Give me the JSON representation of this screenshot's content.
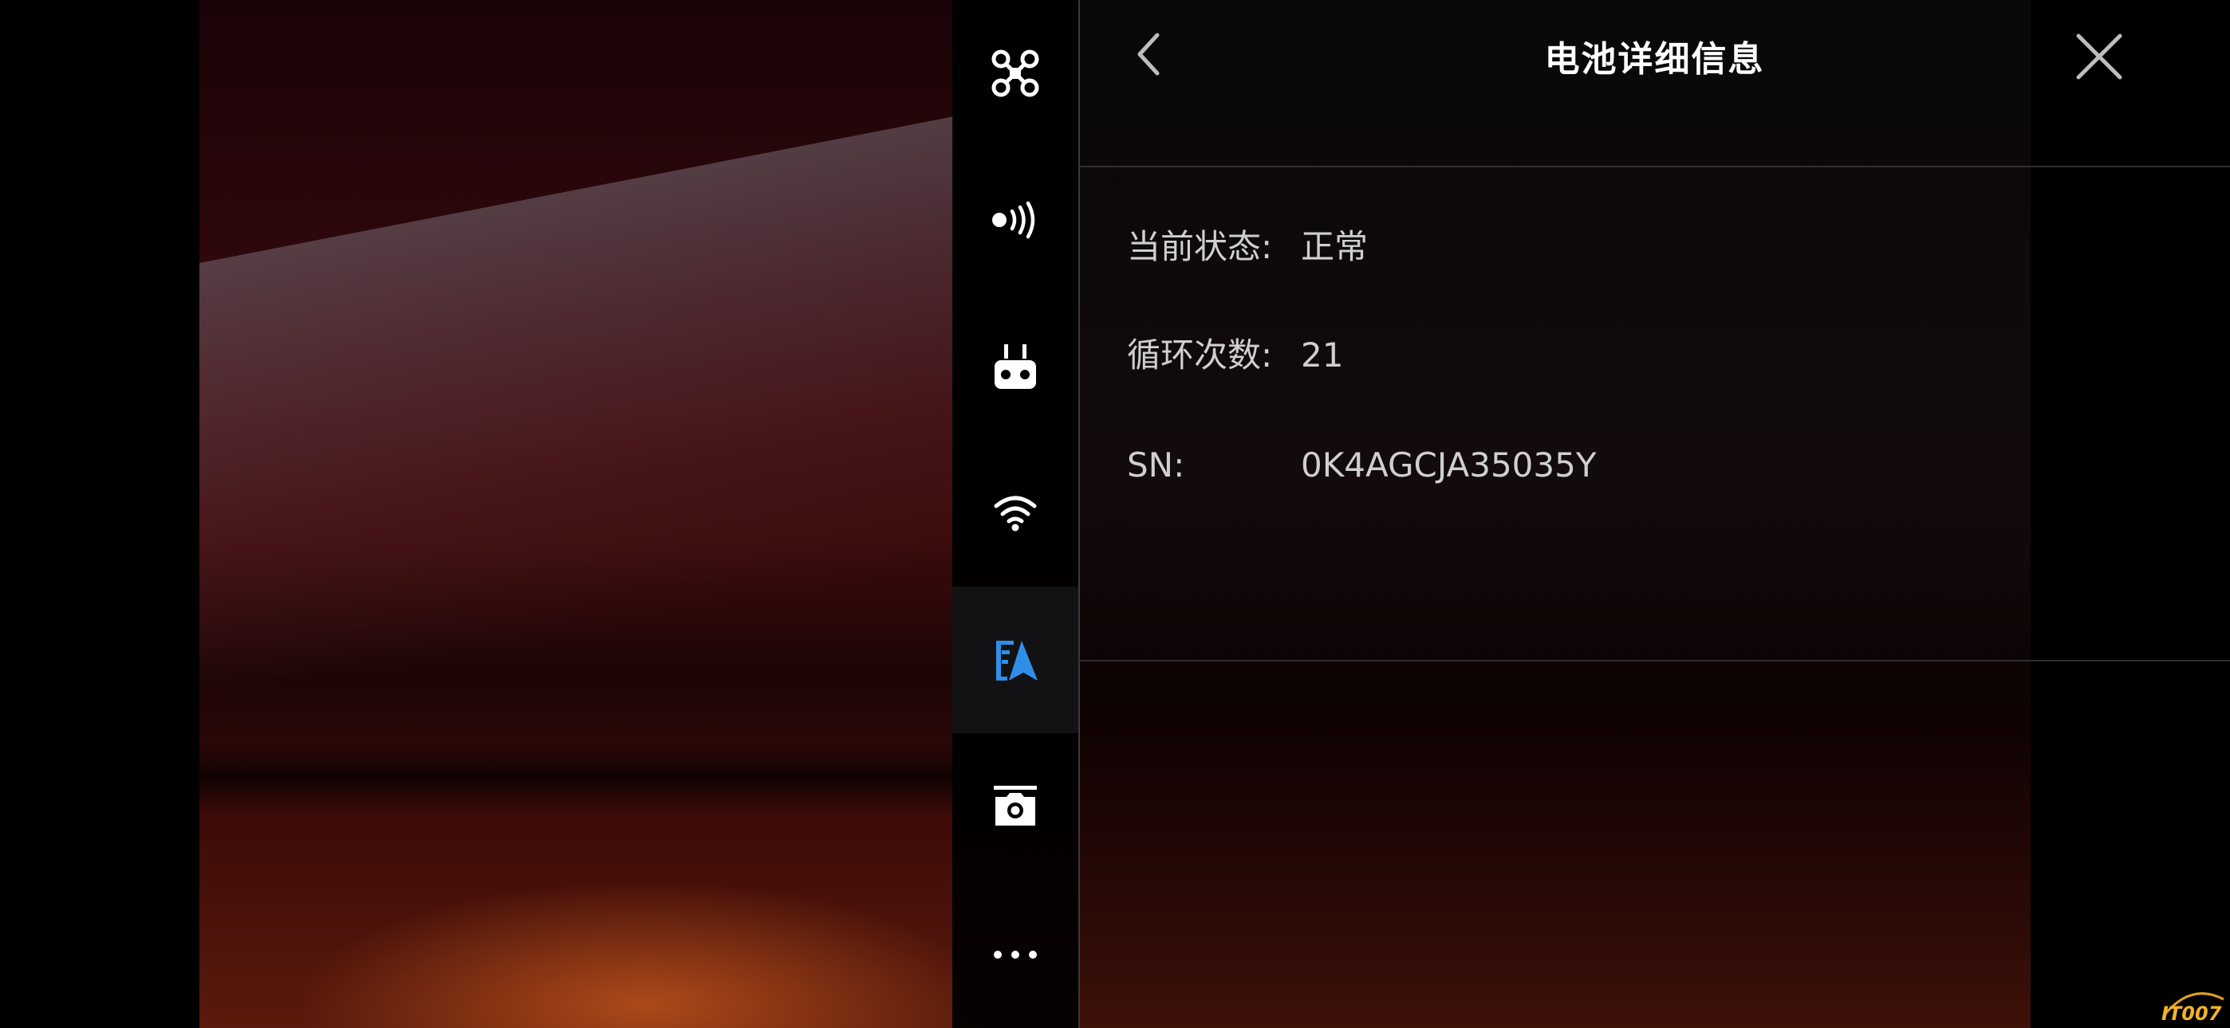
{
  "panel": {
    "title": "电池详细信息",
    "rows": [
      {
        "label": "当前状态:",
        "value": "正常"
      },
      {
        "label": "循环次数:",
        "value": "21"
      },
      {
        "label": "SN:",
        "value": "0K4AGCJA35035Y"
      }
    ]
  },
  "side_rail": {
    "items": [
      {
        "icon": "drone-icon"
      },
      {
        "icon": "signal-icon"
      },
      {
        "icon": "remote-controller-icon"
      },
      {
        "icon": "wifi-icon"
      },
      {
        "icon": "battery-icon",
        "active": true
      },
      {
        "icon": "camera-icon"
      },
      {
        "icon": "more-icon"
      }
    ]
  },
  "colors": {
    "accent": "#2f8fe8",
    "text": "#cfcfcf",
    "title": "#ffffff",
    "divider": "#2e2e2e"
  },
  "watermark": {
    "text": "IT007"
  }
}
